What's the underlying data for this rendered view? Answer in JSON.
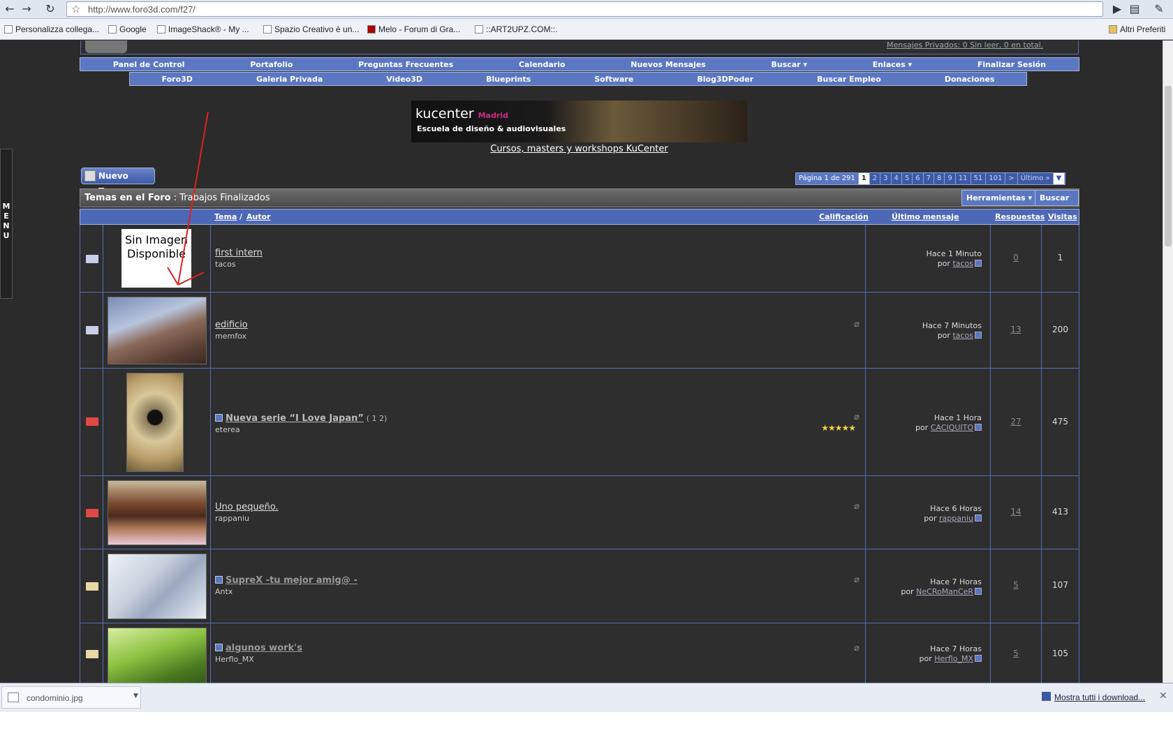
{
  "browser": {
    "url": "http://www.foro3d.com/f27/",
    "bookmarks": [
      "Personalizza collega...",
      "Google",
      "ImageShack® - My ...",
      "Spazio Creativo è un...",
      "Melo - Forum di Gra...",
      "::ART2UPZ.COM::."
    ],
    "other_bookmarks": "Altri Preferiti"
  },
  "side_menu": "MENU",
  "header": {
    "section": "Trabajos Finalizados",
    "pm_text": "Mensajes Privados: 0 Sin leer, 0 en total."
  },
  "nav1": [
    "Panel de Control",
    "Portafolio",
    "Preguntas Frecuentes",
    "Calendario",
    "Nuevos Mensajes",
    "Buscar ▾",
    "Enlaces ▾",
    "Finalizar Sesión"
  ],
  "nav2": [
    "Foro3D",
    "Galeria Privada",
    "Video3D",
    "Blueprints",
    "Software",
    "Blog3DPoder",
    "Buscar Empleo",
    "Donaciones"
  ],
  "banner": {
    "brand": "kucenter",
    "city": "Madrid",
    "tagline": "Escuela de diseño & audiovisuales",
    "link": "Cursos, masters y workshops KuCenter"
  },
  "new_topic": "Nuevo Tema",
  "pager": {
    "label": "Página 1 de 291",
    "pages": [
      "1",
      "2",
      "3",
      "4",
      "5",
      "6",
      "7",
      "8",
      "9",
      "11",
      "51",
      "101",
      ">",
      "Último »"
    ]
  },
  "forum": {
    "title_prefix": "Temas en el Foro",
    "title": "Trabajos Finalizados",
    "tools": "Herramientas ▾",
    "search": "Buscar ▾",
    "cols": {
      "tema": "Tema",
      "autor": "Autor",
      "rating": "Calificación",
      "last": "Último mensaje",
      "replies": "Respuestas",
      "views": "Visitas"
    }
  },
  "no_image": "Sin Imagen Disponible",
  "threads": [
    {
      "title": "first intern",
      "author": "tacos",
      "last_time": "Hace 1 Minuto",
      "last_by": "tacos",
      "replies": "0",
      "views": "1"
    },
    {
      "title": "edificio",
      "author": "memfox",
      "last_time": "Hace 7 Minutos",
      "last_by": "tacos",
      "replies": "13",
      "views": "200"
    },
    {
      "title": "Nueva serie “I Love Japan”",
      "pages": "( 1 2)",
      "author": "eterea",
      "rating": "★★★★★",
      "last_time": "Hace 1 Hora",
      "last_by": "CACIQUITO",
      "replies": "27",
      "views": "475"
    },
    {
      "title": "Uno pequeño.",
      "author": "rappaniu",
      "last_time": "Hace 6 Horas",
      "last_by": "rappaniu",
      "replies": "14",
      "views": "413"
    },
    {
      "title": "SupreX -tu mejor amig@ -",
      "author": "Antx",
      "last_time": "Hace 7 Horas",
      "last_by": "NeCRoManCeR",
      "replies": "5",
      "views": "107"
    },
    {
      "title": "algunos work's",
      "author": "Herflo_MX",
      "last_time": "Hace 7 Horas",
      "last_by": "Herflo_MX",
      "replies": "5",
      "views": "105"
    }
  ],
  "downloads": {
    "file": "condominio.jpg",
    "show_all": "Mostra tutti i download..."
  },
  "colors": {
    "nav_blue": "#5b77c2",
    "border_blue": "#5670b4",
    "bg": "#2b2b2b"
  }
}
